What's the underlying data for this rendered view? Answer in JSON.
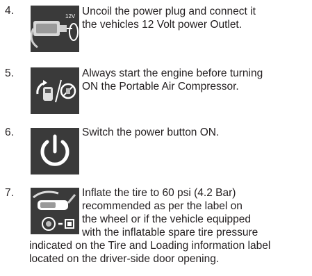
{
  "steps": [
    {
      "number": "4.",
      "icon": "power-plug-12v-icon",
      "icon_label": "12V",
      "lines": [
        "Uncoil the power plug and connect it",
        "the vehicles 12 Volt power Outlet."
      ]
    },
    {
      "number": "5.",
      "icon": "start-engine-before-compressor-icon",
      "lines": [
        "Always start the engine before turning",
        "ON the Portable Air Compressor."
      ]
    },
    {
      "number": "6.",
      "icon": "power-button-icon",
      "lines": [
        "Switch the power button ON."
      ]
    },
    {
      "number": "7.",
      "icon": "tire-inflate-gauge-icon",
      "lines": [
        "Inflate the tire to 60 psi (4.2 Bar)",
        "recommended as per the label on",
        "the wheel or if the vehicle equipped",
        "with the inflatable spare tire pressure",
        "indicated on the Tire and Loading information label",
        "located on the driver-side door opening."
      ]
    }
  ],
  "colors": {
    "text": "#231f20",
    "icon_bg": "#3a3a3a",
    "icon_fg": "#ffffff"
  }
}
